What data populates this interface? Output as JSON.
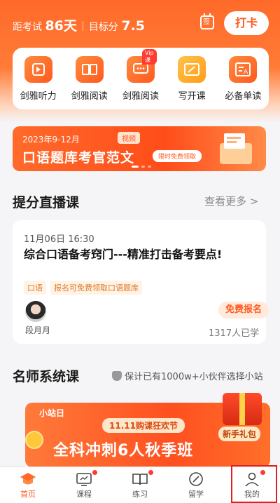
{
  "header": {
    "exam_label": "距考试",
    "exam_days": "86天",
    "target_label": "目标分",
    "target_score": "7.5",
    "calendar_glyph": "签",
    "checkin_label": "打卡"
  },
  "categories": [
    {
      "label": "剑雅听力",
      "icon": "play-icon"
    },
    {
      "label": "剑雅阅读",
      "icon": "book-icon"
    },
    {
      "label": "剑雅阅读",
      "icon": "chat-icon",
      "badge": "Vip课"
    },
    {
      "label": "写开课",
      "icon": "pen-icon"
    },
    {
      "label": "必备单读",
      "icon": "vocab-icon"
    }
  ],
  "banner1": {
    "date": "2023年9-12月",
    "chip": "视频",
    "title": "口语题库考官范文",
    "pill": "限时免费领取"
  },
  "live_section": {
    "title": "提分直播课",
    "more": "查看更多 >",
    "card": {
      "time": "11月06日 16:30",
      "title": "综合口语备考窍门---精准打击备考要点!",
      "tags": [
        "口语",
        "报名可免费领取口语题库"
      ],
      "teacher": "段月月",
      "enroll": "免费报名",
      "learned": "1317人已学"
    }
  },
  "system_section": {
    "title": "名师系统课",
    "trust": "保计已有1000w+小伙伴选择小站"
  },
  "banner2": {
    "logo": "小站日",
    "fest": "11.11购课狂欢节",
    "main": "全科冲刺6人秋季班",
    "gift": "新手礼包"
  },
  "tabs": [
    {
      "label": "首页",
      "icon": "graduation-cap-icon",
      "active": true,
      "dot": false
    },
    {
      "label": "课程",
      "icon": "course-icon",
      "active": false,
      "dot": true
    },
    {
      "label": "练习",
      "icon": "practice-icon",
      "active": false,
      "dot": true
    },
    {
      "label": "留学",
      "icon": "compass-icon",
      "active": false,
      "dot": false
    },
    {
      "label": "我的",
      "icon": "user-icon",
      "active": false,
      "dot": true
    }
  ],
  "colors": {
    "accent": "#ff5a1f",
    "highlight": "#e02020"
  }
}
